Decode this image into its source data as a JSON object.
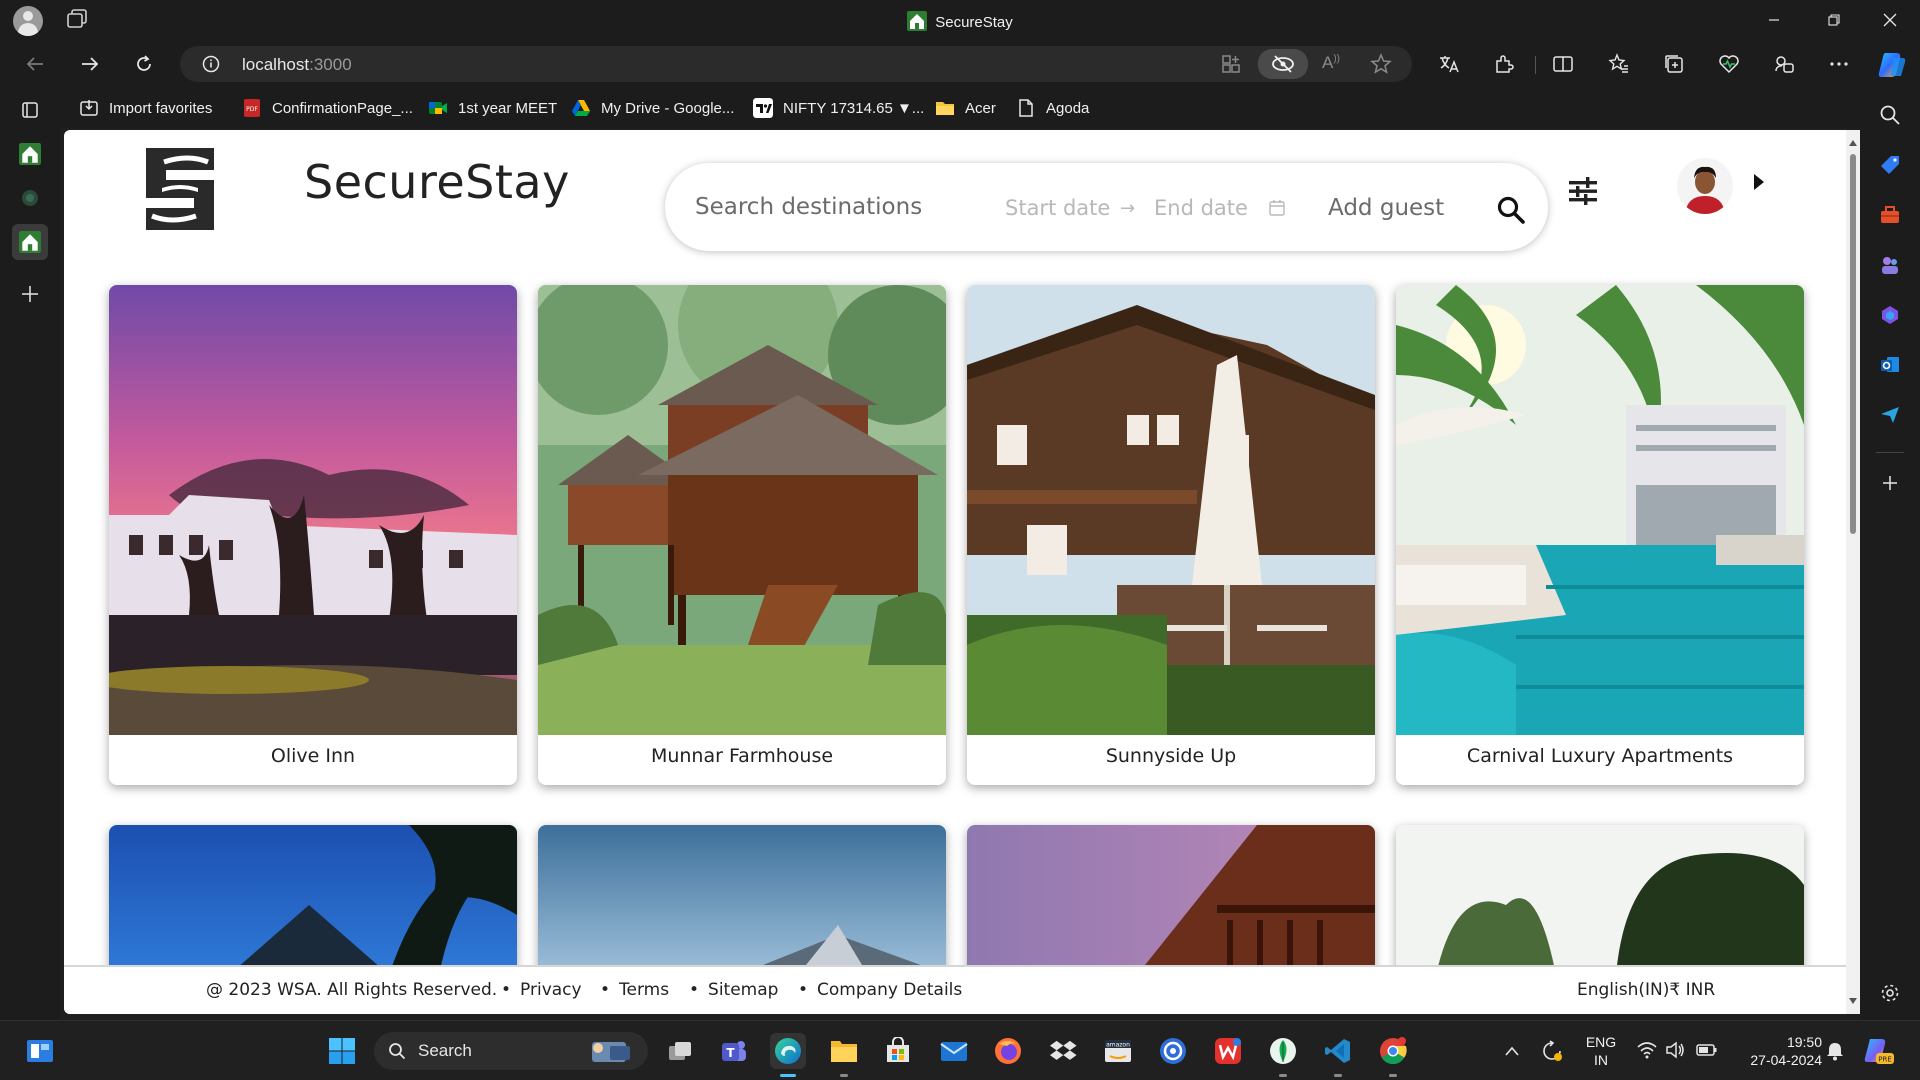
{
  "browser": {
    "window_title": "SecureStay",
    "url_host": "localhost",
    "url_port": ":3000",
    "favorites": [
      {
        "label": "Import favorites",
        "icon": "import-icon"
      },
      {
        "label": "ConfirmationPage_...",
        "icon": "pdf-icon"
      },
      {
        "label": "1st year MEET",
        "icon": "meet-icon"
      },
      {
        "label": "My Drive - Google...",
        "icon": "drive-icon"
      },
      {
        "label": "NIFTY 17314.65 ▼...",
        "icon": "tradingview-icon"
      },
      {
        "label": "Acer",
        "icon": "folder-icon"
      },
      {
        "label": "Agoda",
        "icon": "page-icon"
      }
    ]
  },
  "site": {
    "brand": "SecureStay",
    "search": {
      "destination_placeholder": "Search destinations",
      "start_date": "Start date",
      "date_arrow": "→",
      "end_date": "End date",
      "guest_placeholder": "Add guest"
    },
    "properties": [
      {
        "name": "Olive Inn"
      },
      {
        "name": "Munnar Farmhouse"
      },
      {
        "name": "Sunnyside Up"
      },
      {
        "name": "Carnival Luxury Apartments"
      }
    ],
    "footer": {
      "copyright": "@ 2023 WSA. All Rights Reserved.",
      "links": [
        "Privacy",
        "Terms",
        "Sitemap",
        "Company Details"
      ],
      "locale": "English(IN)₹ INR"
    }
  },
  "taskbar": {
    "search_label": "Search",
    "language": "ENG",
    "region": "IN",
    "time": "19:50",
    "date": "27-04-2024"
  },
  "colors": {
    "chrome_bg": "#1c1c1c",
    "brand_green": "#2e7d32",
    "page_bg": "#ffffff",
    "text_dark": "#222222"
  }
}
